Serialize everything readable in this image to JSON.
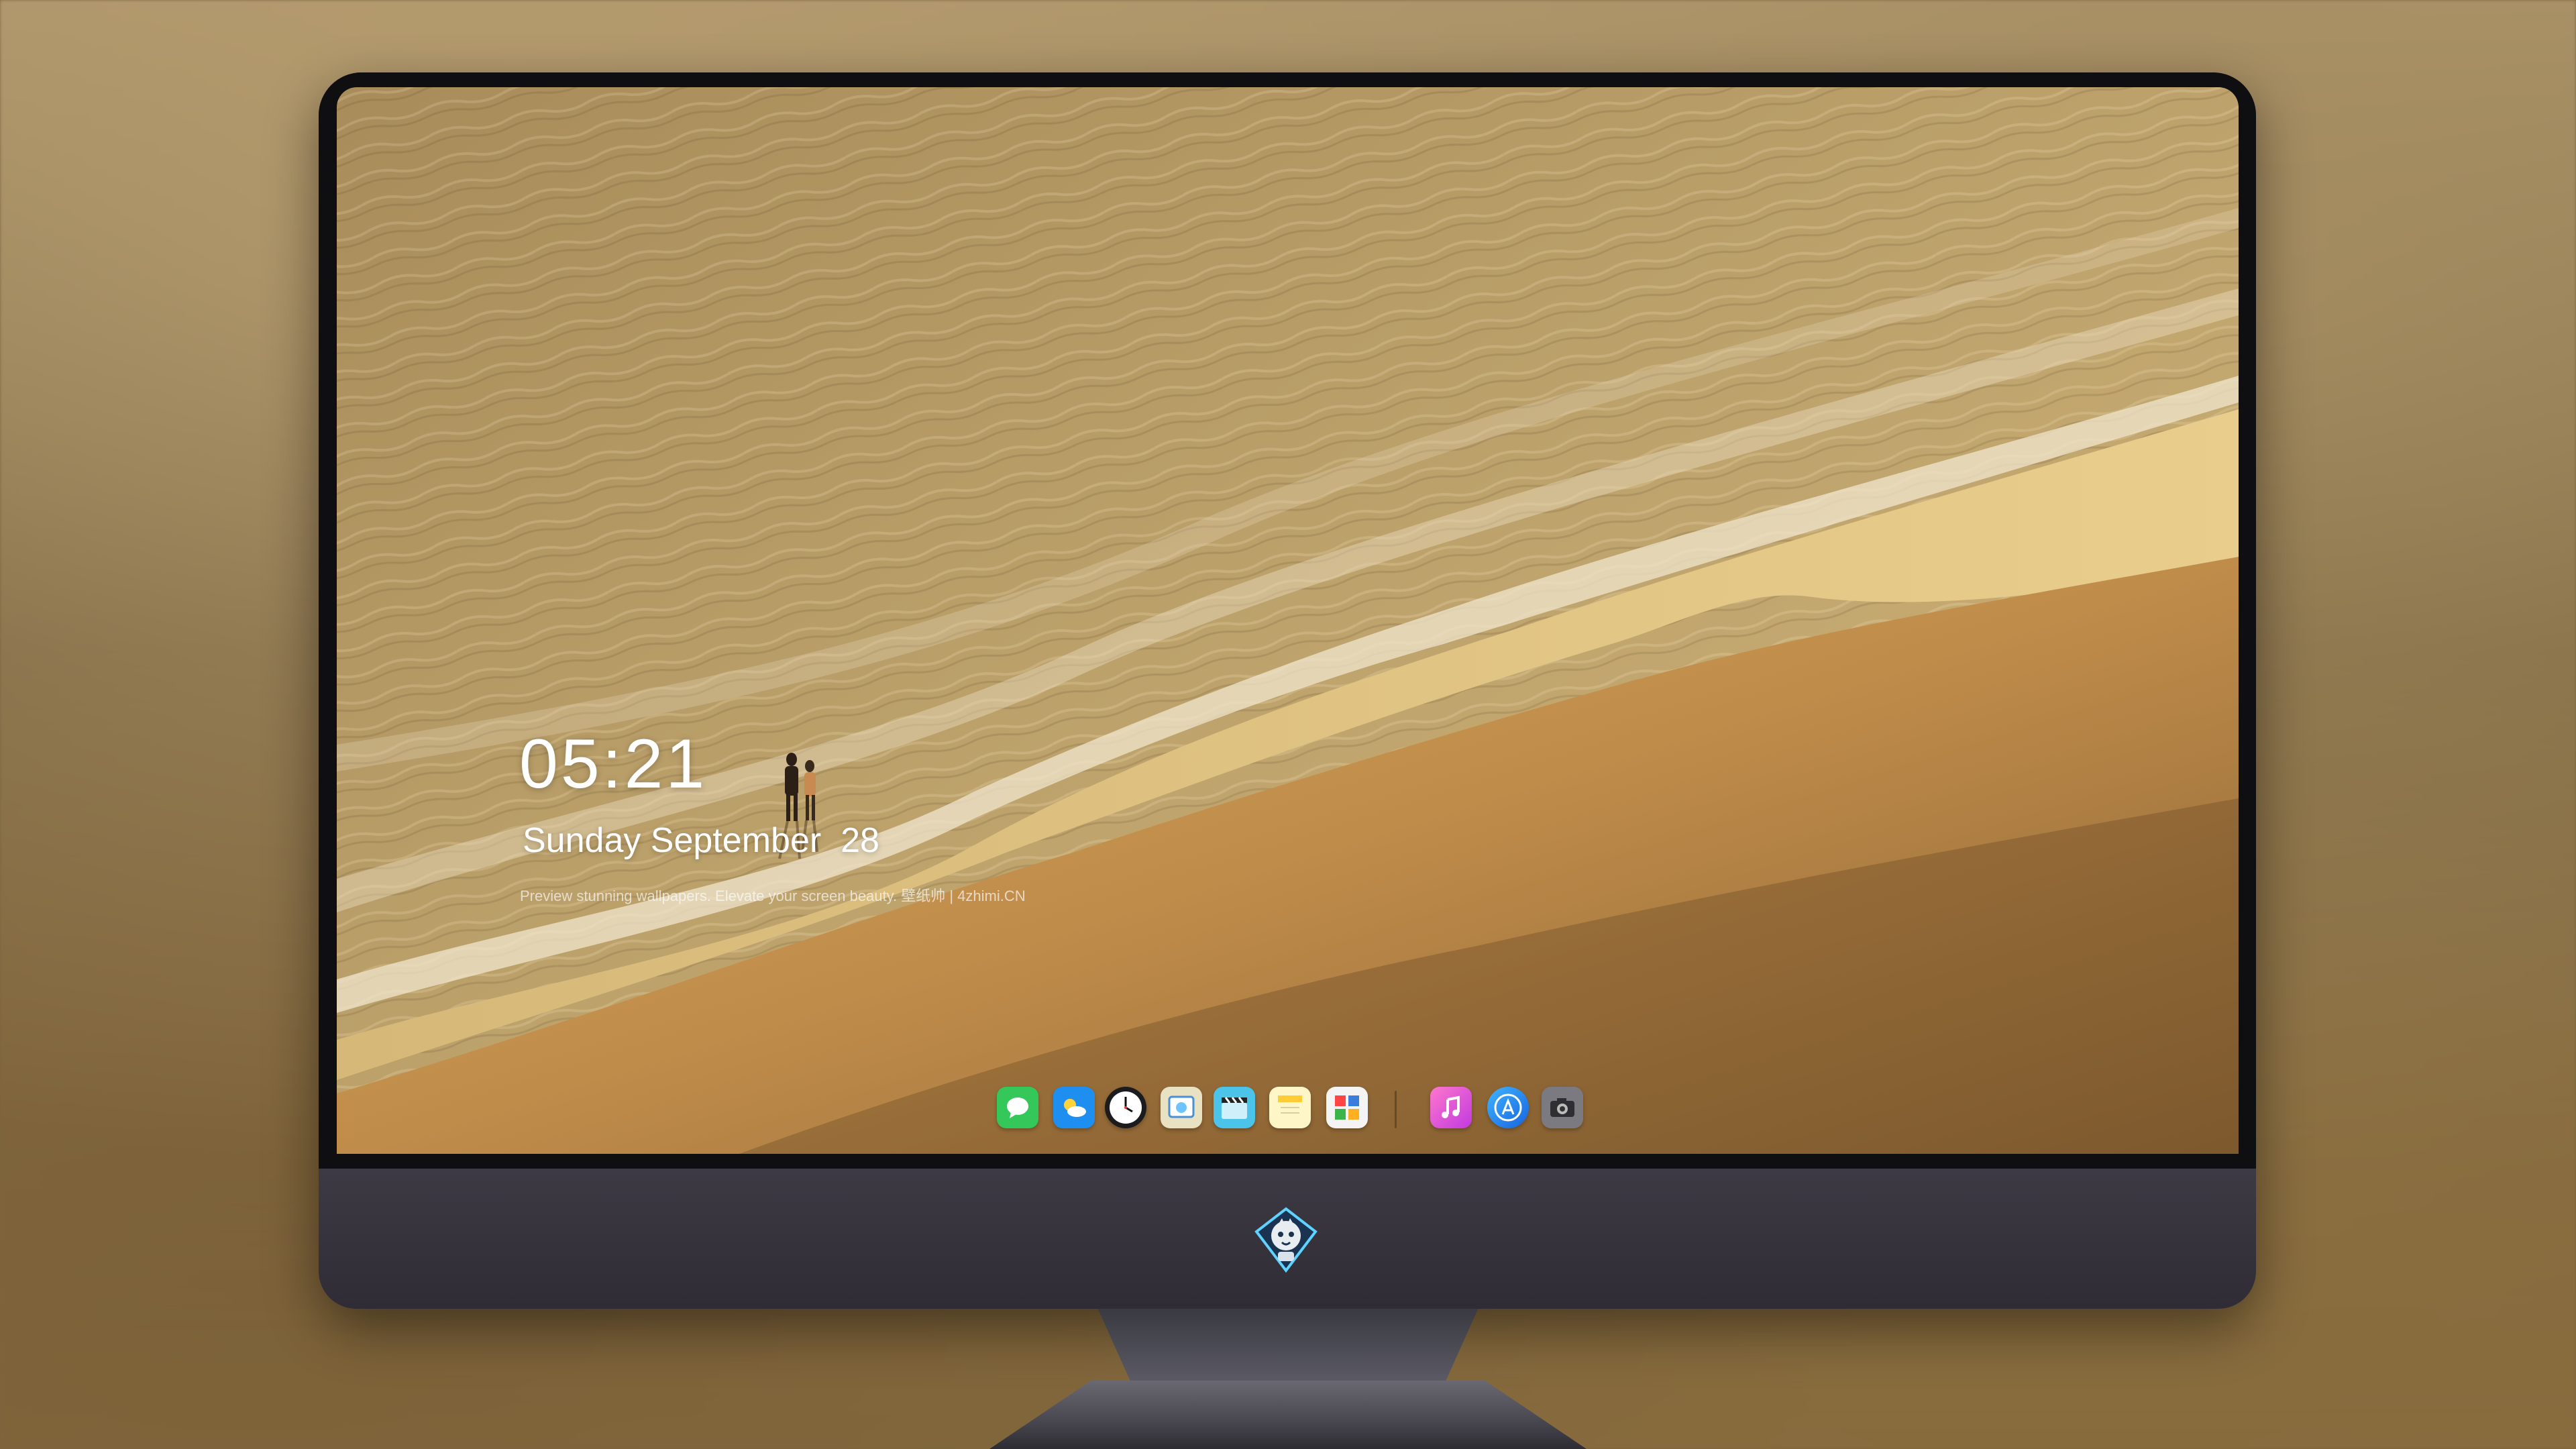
{
  "lockscreen": {
    "time": "05:21",
    "date": "Sunday September  28",
    "caption": "Preview stunning wallpapers. Elevate your screen beauty. 壁纸帅 | 4zhimi.CN"
  },
  "dock": {
    "apps": [
      {
        "icon": "messages-icon",
        "color": "#34c759"
      },
      {
        "icon": "weather-icon",
        "color": "#1e8ff0"
      },
      {
        "icon": "clock-icon",
        "color": "#1c1c1e"
      },
      {
        "icon": "preview-icon",
        "color": "#e9e2c2"
      },
      {
        "icon": "clapper-icon",
        "color": "#4cc3e8"
      },
      {
        "icon": "notes-icon",
        "color": "#fff6c8"
      },
      {
        "icon": "photos-grid-icon",
        "color": "#f4f4f4"
      },
      {
        "icon": "music-icon",
        "color": "#f05bd6"
      },
      {
        "icon": "app-store-icon",
        "color": "#1a7cf5"
      },
      {
        "icon": "camera-icon",
        "color": "#7a7a80"
      }
    ]
  },
  "colors": {
    "sea": "#b69a62",
    "sand": "#c3924f",
    "bezel": "#0f0f12",
    "chin": "#35323b"
  }
}
